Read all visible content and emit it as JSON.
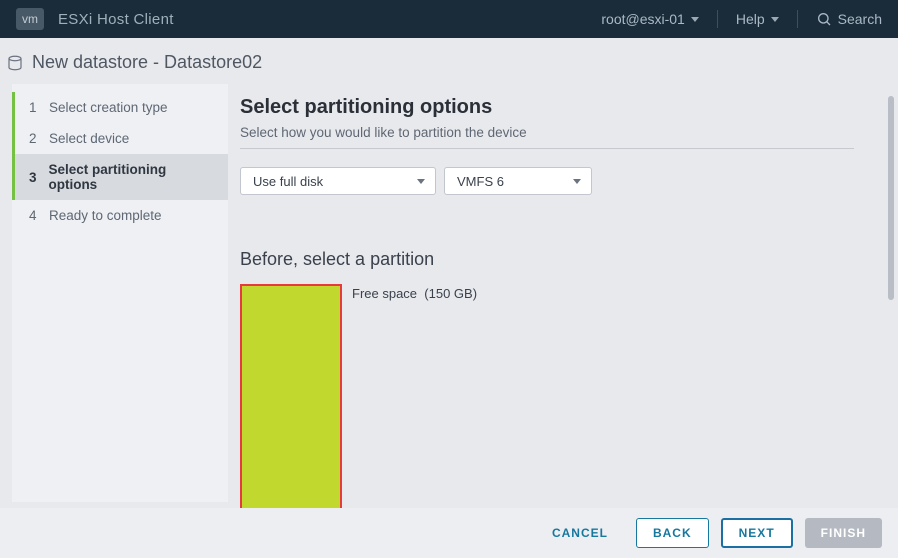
{
  "topbar": {
    "logo": "vm",
    "app_title": "ESXi Host Client",
    "user": "root@esxi-01",
    "help": "Help",
    "search": "Search"
  },
  "wizard": {
    "title": "New datastore - Datastore02",
    "steps": [
      {
        "num": "1",
        "label": "Select creation type"
      },
      {
        "num": "2",
        "label": "Select device"
      },
      {
        "num": "3",
        "label": "Select partitioning options"
      },
      {
        "num": "4",
        "label": "Ready to complete"
      }
    ]
  },
  "content": {
    "title": "Select partitioning options",
    "subtitle": "Select how you would like to partition the device",
    "disk_mode": "Use full disk",
    "vmfs_version": "VMFS 6",
    "before_title": "Before, select a partition",
    "partition": {
      "label": "Free space",
      "size": "(150 GB)"
    }
  },
  "footer": {
    "cancel": "CANCEL",
    "back": "BACK",
    "next": "NEXT",
    "finish": "FINISH"
  },
  "colors": {
    "partition_fill": "#c1d82f",
    "partition_border": "#e83a3a",
    "accent_green": "#76c043",
    "primary_blue": "#16789e"
  }
}
